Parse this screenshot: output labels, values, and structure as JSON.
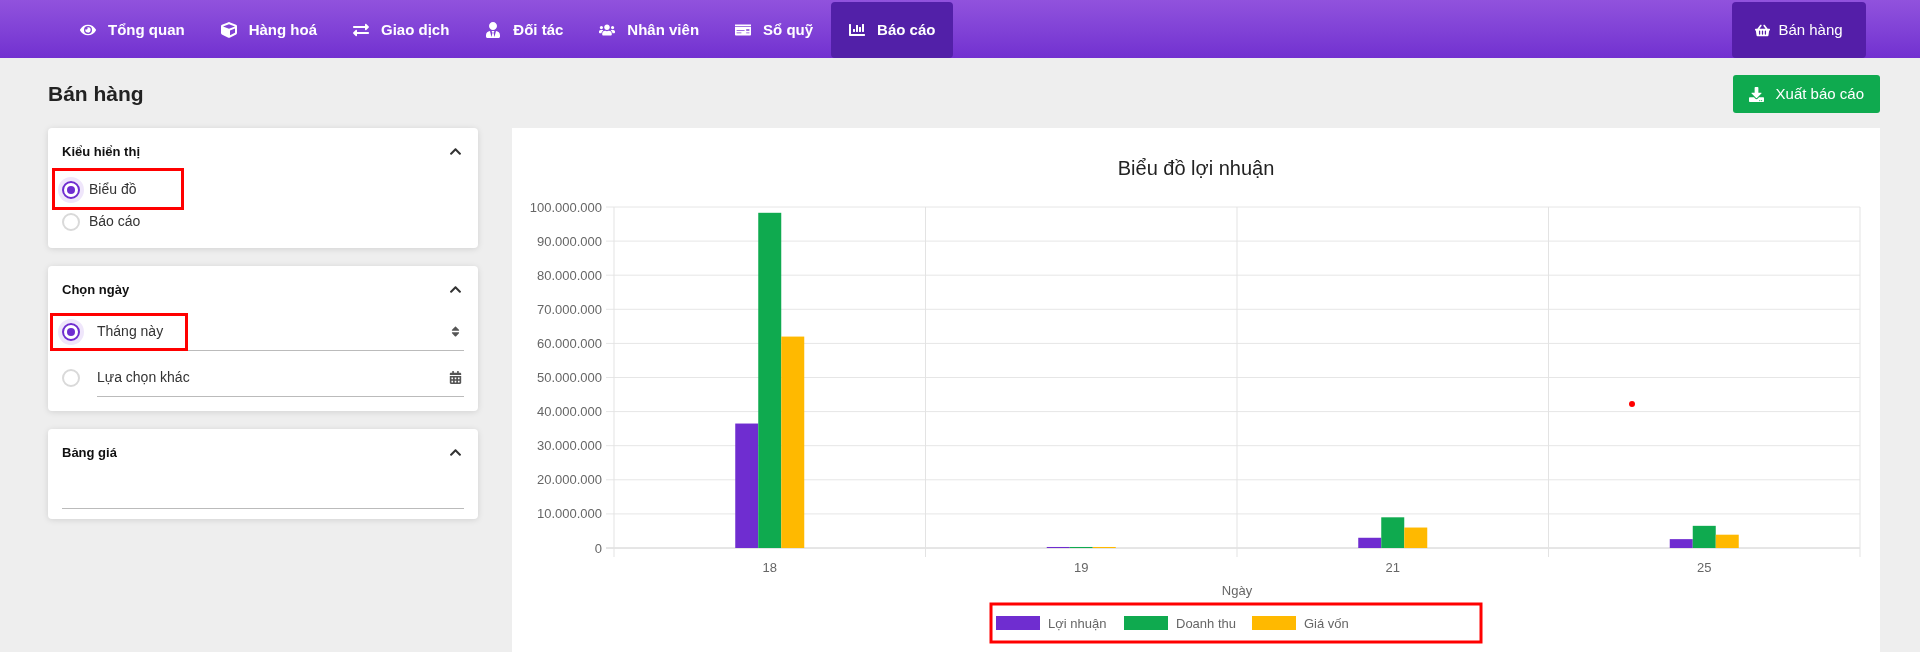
{
  "nav": {
    "items": [
      {
        "label": "Tổng quan",
        "selected": false
      },
      {
        "label": "Hàng hoá",
        "selected": false
      },
      {
        "label": "Giao dịch",
        "selected": false
      },
      {
        "label": "Đối tác",
        "selected": false
      },
      {
        "label": "Nhân viên",
        "selected": false
      },
      {
        "label": "Sổ quỹ",
        "selected": false
      },
      {
        "label": "Báo cáo",
        "selected": true
      }
    ],
    "sales_button": "Bán hàng"
  },
  "page": {
    "title": "Bán hàng",
    "export_button": "Xuất báo cáo"
  },
  "filters": [
    {
      "title": "Kiểu hiển thị",
      "expanded": true,
      "kind": "radio_list",
      "options": [
        {
          "label": "Biểu đồ",
          "selected": true
        },
        {
          "label": "Báo cáo",
          "selected": false
        }
      ]
    },
    {
      "title": "Chọn ngày",
      "expanded": true,
      "kind": "field_options",
      "options": [
        {
          "label": "Tháng này",
          "selected": true,
          "kind": "select"
        },
        {
          "label": "Lựa chọn khác",
          "selected": false,
          "kind": "calendar"
        }
      ]
    },
    {
      "title": "Bảng giá",
      "expanded": true,
      "kind": "field"
    }
  ],
  "chart": {
    "chart_data": {
      "type": "bar",
      "title": "Biểu đồ lợi nhuận",
      "xlabel": "Ngày",
      "categories": [
        "18",
        "19",
        "21",
        "25"
      ],
      "series": [
        {
          "name": "Lợi nhuận",
          "color": "#6f2dd0",
          "values": [
            36500000,
            300000,
            3000000,
            2600000
          ]
        },
        {
          "name": "Doanh thu",
          "color": "#0faa4f",
          "values": [
            98300000,
            300000,
            9000000,
            6500000
          ]
        },
        {
          "name": "Giá vốn",
          "color": "#ffb900",
          "values": [
            62000000,
            300000,
            6000000,
            3900000
          ]
        }
      ],
      "ylim": [
        0,
        100000000
      ],
      "grid": true,
      "legend": true,
      "yticks": [
        {
          "value": 0,
          "label": "0"
        },
        {
          "value": 10000000,
          "label": "10.000.000"
        },
        {
          "value": 20000000,
          "label": "20.000.000"
        },
        {
          "value": 30000000,
          "label": "30.000.000"
        },
        {
          "value": 40000000,
          "label": "40.000.000"
        },
        {
          "value": 50000000,
          "label": "50.000.000"
        },
        {
          "value": 60000000,
          "label": "60.000.000"
        },
        {
          "value": 70000000,
          "label": "70.000.000"
        },
        {
          "value": 80000000,
          "label": "80.000.000"
        },
        {
          "value": 90000000,
          "label": "90.000.000"
        },
        {
          "value": 100000000,
          "label": "100.000.000"
        }
      ]
    }
  }
}
